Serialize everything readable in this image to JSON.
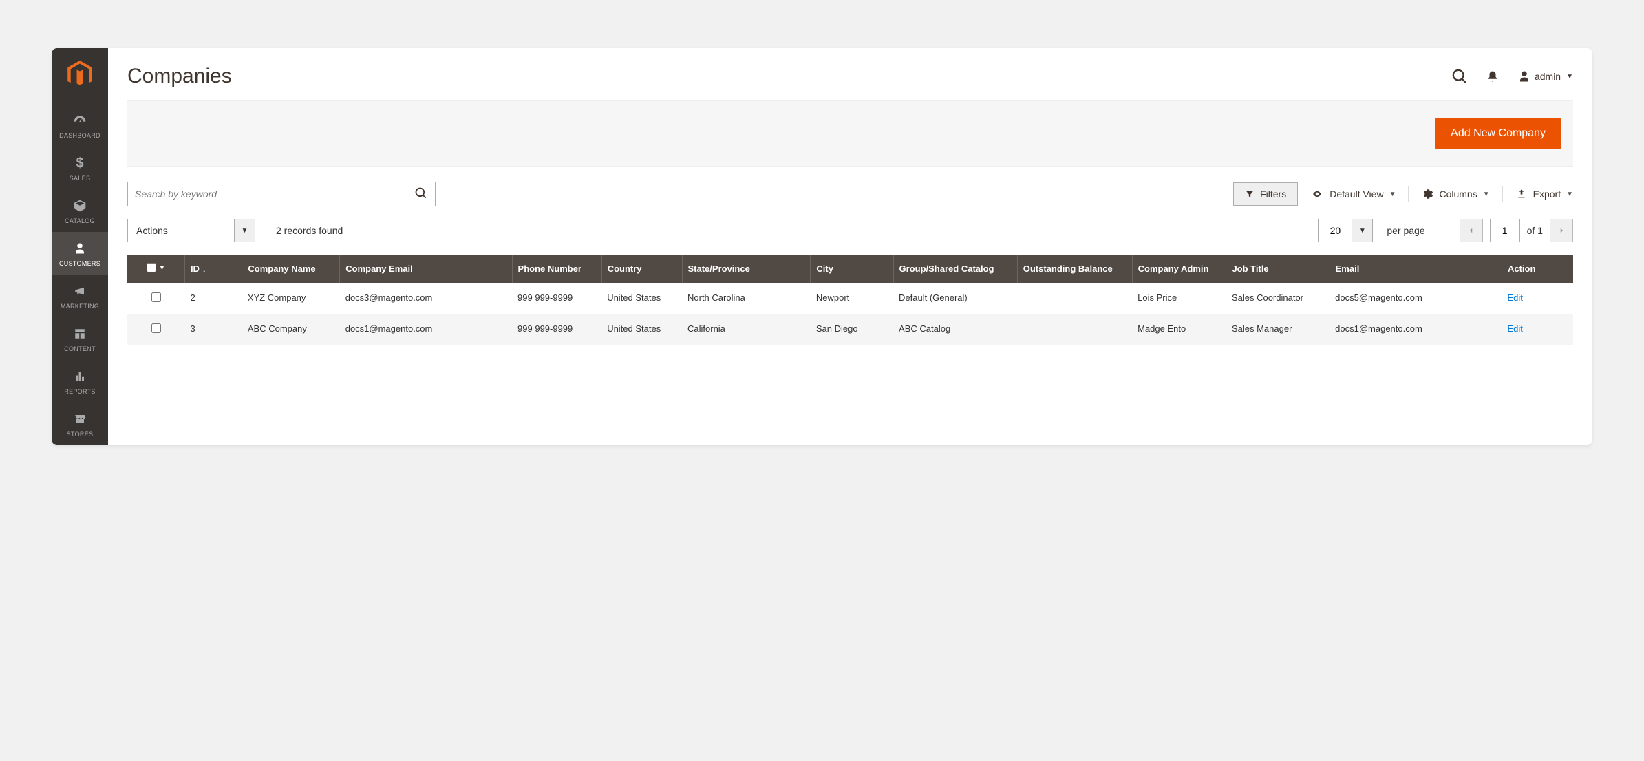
{
  "sidebar": {
    "items": [
      {
        "label": "DASHBOARD"
      },
      {
        "label": "SALES"
      },
      {
        "label": "CATALOG"
      },
      {
        "label": "CUSTOMERS"
      },
      {
        "label": "MARKETING"
      },
      {
        "label": "CONTENT"
      },
      {
        "label": "REPORTS"
      },
      {
        "label": "STORES"
      }
    ]
  },
  "header": {
    "title": "Companies",
    "admin_label": "admin"
  },
  "actions": {
    "add_new_company": "Add New Company"
  },
  "search": {
    "placeholder": "Search by keyword"
  },
  "toolbar": {
    "filters": "Filters",
    "default_view": "Default View",
    "columns": "Columns",
    "export": "Export"
  },
  "controls": {
    "actions_label": "Actions",
    "records_found": "2 records found",
    "per_page_value": "20",
    "per_page_label": "per page",
    "page_value": "1",
    "of_label": "of 1"
  },
  "grid": {
    "headers": {
      "id": "ID",
      "company_name": "Company Name",
      "company_email": "Company Email",
      "phone": "Phone Number",
      "country": "Country",
      "state": "State/Province",
      "city": "City",
      "group": "Group/Shared Catalog",
      "balance": "Outstanding Balance",
      "admin": "Company Admin",
      "job": "Job Title",
      "email": "Email",
      "action": "Action"
    },
    "rows": [
      {
        "id": "2",
        "company_name": "XYZ Company",
        "company_email": "docs3@magento.com",
        "phone": "999 999-9999",
        "country": "United States",
        "state": "North Carolina",
        "city": "Newport",
        "group": "Default (General)",
        "balance": "",
        "admin": "Lois Price",
        "job": "Sales Coordinator",
        "email": "docs5@magento.com",
        "action": "Edit"
      },
      {
        "id": "3",
        "company_name": "ABC Company",
        "company_email": "docs1@magento.com",
        "phone": "999 999-9999",
        "country": "United States",
        "state": "California",
        "city": "San Diego",
        "group": "ABC Catalog",
        "balance": "",
        "admin": "Madge Ento",
        "job": "Sales Manager",
        "email": "docs1@magento.com",
        "action": "Edit"
      }
    ]
  }
}
